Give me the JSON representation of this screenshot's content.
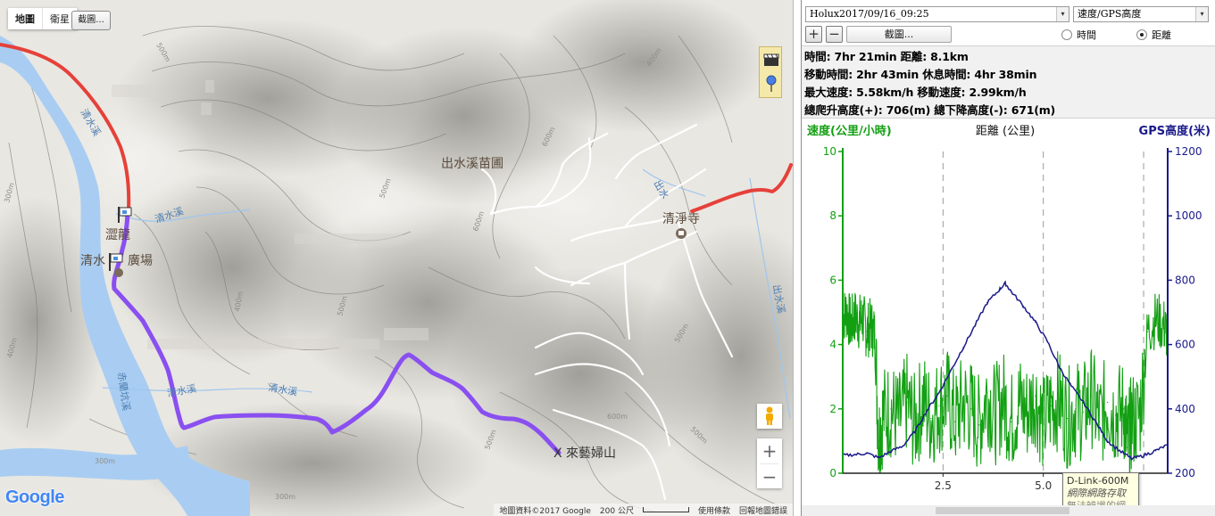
{
  "map": {
    "map_type_tabs": [
      "地圖",
      "衛星"
    ],
    "capture_button": "截圖...",
    "attribution": {
      "data": "地圖資料©2017 Google",
      "scale": "200 公尺",
      "terms": "使用條款",
      "report": "回報地圖錯誤"
    },
    "google_logo": "Google",
    "zoom_in": "+",
    "zoom_out": "−",
    "labels": {
      "nursery": "出水溪苗圃",
      "temple": "清淨寺",
      "plaza_left": "清水",
      "plaza_right": "廣場",
      "dragon": "澀龍",
      "destination": "X 來藝婦山",
      "river_qingshui_1": "清水溪",
      "river_qingshui_2": "清水溪",
      "river_qingshui_3": "清水溪",
      "river_qingshui_4": "清水溪",
      "river_chushui_1": "出水",
      "river_chushui_2": "出水溪",
      "river_chilan": "赤蘭坑溪"
    },
    "contour_labels": [
      "500m",
      "400m",
      "600m",
      "500m",
      "600m",
      "400m",
      "500m",
      "300m",
      "400m",
      "500m",
      "600m",
      "500m",
      "300m",
      "500m",
      "300m"
    ],
    "colors": {
      "track_purple": "#8a4ff0",
      "road_red": "#e5413a",
      "river": "#a9cdf2",
      "terrain": "#e9e7e2",
      "trail_white": "#ffffff"
    }
  },
  "panel": {
    "track_file": "Holux2017/09/16_09:25",
    "chart_mode": "速度/GPS高度",
    "zoom_in": "+",
    "zoom_out": "−",
    "capture": "截圖...",
    "radio_time": "時間",
    "radio_distance": "距離",
    "selected_radio": "距離",
    "stats": {
      "line1": "時間: 7hr 21min  距離: 8.1km",
      "line2": "移動時間: 2hr 43min  休息時間: 4hr 38min",
      "line3": "最大速度: 5.58km/h  移動速度: 2.99km/h",
      "line4": "總爬升高度(+): 706(m)  總下降高度(-): 671(m)"
    },
    "tooltip": {
      "line1": "D-Link-600M",
      "line2": "網際網路存取",
      "line3": "無法辨識的網路"
    }
  },
  "chart_data": {
    "type": "line",
    "title": "距離 (公里)",
    "xlabel": "距離 (公里)",
    "ylabel_left": "速度(公里/小時)",
    "ylabel_right": "GPS高度(米)",
    "xlim": [
      0,
      8.1
    ],
    "ylim_left": [
      0,
      10
    ],
    "ylim_right": [
      200,
      1200
    ],
    "x_ticks": [
      "2.5",
      "5.0"
    ],
    "left_ticks": [
      "0",
      "2",
      "4",
      "6",
      "8",
      "10"
    ],
    "right_ticks": [
      "200",
      "400",
      "600",
      "800",
      "1000",
      "1200"
    ],
    "grid": "vertical dashed at 2.5, 5.0, 7.5",
    "series": [
      {
        "name": "速度(公里/小時)",
        "color": "#12a012",
        "axis": "left",
        "x": [
          0,
          0.1,
          0.2,
          0.3,
          0.4,
          0.5,
          0.6,
          0.7,
          0.8,
          0.9,
          1.0,
          1.2,
          1.4,
          1.6,
          1.8,
          2.0,
          2.2,
          2.4,
          2.6,
          2.8,
          3.0,
          3.2,
          3.4,
          3.6,
          3.8,
          4.0,
          4.2,
          4.4,
          4.6,
          4.8,
          5.0,
          5.2,
          5.4,
          5.6,
          5.8,
          6.0,
          6.2,
          6.4,
          6.6,
          6.8,
          7.0,
          7.1,
          7.2,
          7.4,
          7.6,
          7.8,
          8.0,
          8.1
        ],
        "values": [
          4.9,
          5.0,
          4.6,
          4.9,
          4.7,
          4.8,
          4.4,
          4.6,
          4.3,
          1.0,
          1.8,
          2.0,
          1.6,
          2.2,
          1.5,
          2.3,
          1.7,
          2.1,
          2.4,
          1.6,
          2.2,
          2.0,
          1.5,
          2.5,
          1.8,
          2.3,
          1.6,
          2.2,
          1.9,
          2.4,
          1.5,
          2.1,
          2.3,
          1.7,
          2.0,
          1.9,
          2.4,
          1.6,
          2.2,
          1.8,
          2.0,
          0.8,
          1.6,
          1.8,
          4.4,
          4.8,
          4.6,
          4.3
        ]
      },
      {
        "name": "GPS高度(米)",
        "color": "#1a1a8a",
        "axis": "right",
        "x": [
          0,
          0.3,
          0.6,
          0.9,
          1.2,
          1.5,
          1.8,
          2.1,
          2.4,
          2.7,
          3.0,
          3.3,
          3.6,
          3.9,
          4.05,
          4.2,
          4.5,
          4.8,
          5.1,
          5.4,
          5.7,
          6.0,
          6.3,
          6.6,
          6.9,
          7.2,
          7.5,
          7.8,
          8.1
        ],
        "values": [
          255,
          258,
          262,
          248,
          268,
          285,
          330,
          395,
          450,
          520,
          590,
          660,
          730,
          770,
          790,
          765,
          720,
          670,
          610,
          530,
          470,
          420,
          360,
          300,
          270,
          245,
          255,
          270,
          288
        ]
      }
    ]
  }
}
